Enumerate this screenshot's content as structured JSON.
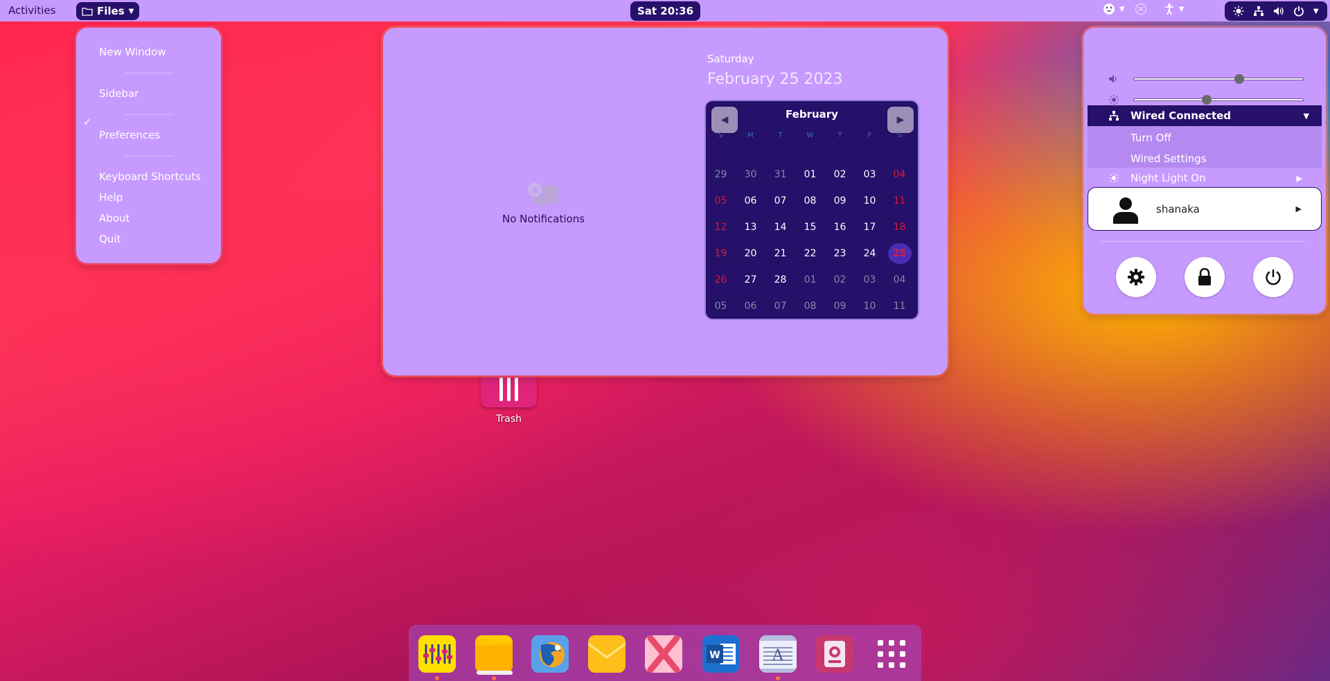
{
  "topbar": {
    "activities": "Activities",
    "app_menu_label": "Files",
    "clock": "Sat 20:36"
  },
  "files_menu": {
    "items": [
      {
        "label": "New Window"
      },
      {
        "label": "Sidebar",
        "checked": true
      },
      {
        "label": "Preferences"
      },
      {
        "label": "Keyboard Shortcuts"
      },
      {
        "label": "Help"
      },
      {
        "label": "About"
      },
      {
        "label": "Quit"
      }
    ],
    "check_mark": "✓"
  },
  "notifications": {
    "empty_text": "No Notifications"
  },
  "date": {
    "weekday": "Saturday",
    "full_date": "February 25 2023"
  },
  "calendar": {
    "month": "February",
    "day_headers": [
      "S",
      "M",
      "T",
      "W",
      "T",
      "F",
      "S"
    ],
    "weeks": [
      [
        "29",
        "30",
        "31",
        "01",
        "02",
        "03",
        "04"
      ],
      [
        "05",
        "06",
        "07",
        "08",
        "09",
        "10",
        "11"
      ],
      [
        "12",
        "13",
        "14",
        "15",
        "16",
        "17",
        "18"
      ],
      [
        "19",
        "20",
        "21",
        "22",
        "23",
        "24",
        "25"
      ],
      [
        "26",
        "27",
        "28",
        "01",
        "02",
        "03",
        "04"
      ],
      [
        "05",
        "06",
        "07",
        "08",
        "09",
        "10",
        "11"
      ]
    ],
    "today": "25",
    "colors": {
      "weekend": "#d81b3a",
      "today_bg": "#4b2db3",
      "background": "#25106a"
    }
  },
  "desktop": {
    "trash_label": "Trash"
  },
  "system_menu": {
    "volume_level": 0.62,
    "brightness_level": 0.43,
    "network": {
      "label": "Wired Connected",
      "sub_items": [
        "Turn Off",
        "Wired Settings"
      ]
    },
    "night_light": "Night Light On",
    "user_name": "shanaka",
    "buttons": [
      "settings",
      "lock",
      "power"
    ]
  },
  "dock": {
    "apps": [
      {
        "name": "mixer-app",
        "color": "#ffe000",
        "running": true
      },
      {
        "name": "files-app",
        "color": "#ffc400",
        "running": true,
        "focused": true
      },
      {
        "name": "firefox-app",
        "color": "#3a8fd8",
        "running": false
      },
      {
        "name": "mail-app",
        "color": "#ffb300",
        "running": false
      },
      {
        "name": "app-x",
        "color": "#e84b8a",
        "running": false
      },
      {
        "name": "word-app",
        "color": "#1e6fd0",
        "running": false
      },
      {
        "name": "text-editor-app",
        "color": "#9aa4d0",
        "running": true
      },
      {
        "name": "screenshot-app",
        "color": "#c2306a",
        "running": false
      },
      {
        "name": "app-grid",
        "color": "transparent",
        "running": false
      }
    ]
  },
  "theme": {
    "panel_bg": "#c79aff",
    "accent_dark": "#27106a"
  }
}
